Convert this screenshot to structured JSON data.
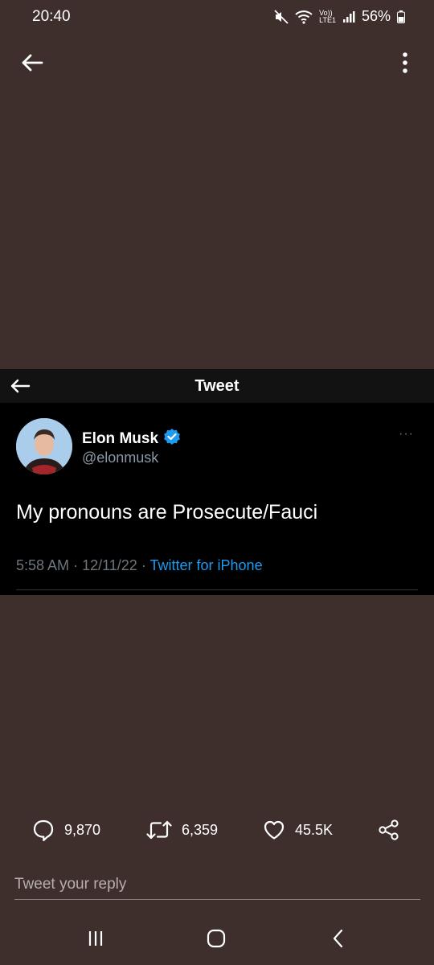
{
  "status_bar": {
    "time": "20:40",
    "network_label": "LTE1",
    "volte_label": "Vo))",
    "battery_percent": "56%",
    "icons": [
      "mute-icon",
      "wifi-icon",
      "signal-icon",
      "battery-icon"
    ]
  },
  "viewer": {
    "back_icon": "arrow-left-icon",
    "more_icon": "more-vertical-icon"
  },
  "tweet": {
    "header_title": "Tweet",
    "author_name": "Elon Musk",
    "author_handle": "@elonmusk",
    "verified": true,
    "text": "My pronouns are Prosecute/Fauci",
    "time": "5:58 AM",
    "date": "12/11/22",
    "separator": "·",
    "source": "Twitter for iPhone",
    "more": "···"
  },
  "actions": {
    "replies": "9,870",
    "retweets": "6,359",
    "likes": "45.5K"
  },
  "reply": {
    "placeholder": "Tweet your reply"
  },
  "colors": {
    "background": "#3e2f2d",
    "tweet_bg": "#000000",
    "link": "#1d9bf0",
    "muted": "#6e767d"
  }
}
